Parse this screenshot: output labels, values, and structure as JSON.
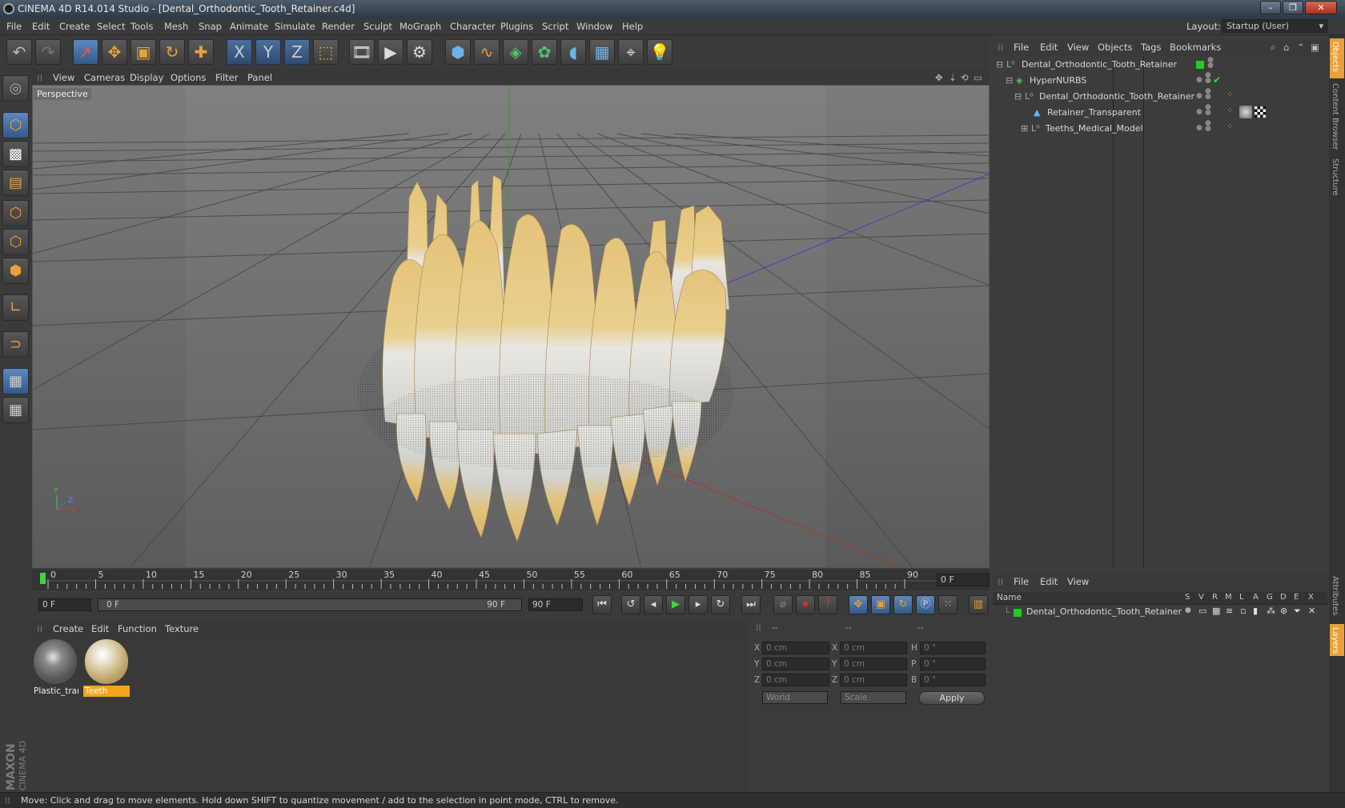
{
  "window": {
    "title": "CINEMA 4D R14.014 Studio - [Dental_Orthodontic_Tooth_Retainer.c4d]",
    "layout_label": "Layout:",
    "layout_value": "Startup (User)"
  },
  "menu": [
    "File",
    "Edit",
    "Create",
    "Select",
    "Tools",
    "Mesh",
    "Snap",
    "Animate",
    "Simulate",
    "Render",
    "Sculpt",
    "MoGraph",
    "Character",
    "Plugins",
    "Script",
    "Window",
    "Help"
  ],
  "toolbar": {
    "icons": [
      "undo-icon",
      "redo-icon",
      "live-select-icon",
      "move-icon",
      "scale-icon",
      "rotate-icon",
      "add-icon",
      "x-axis-icon",
      "y-axis-icon",
      "z-axis-icon",
      "coordinate-system-icon",
      "render-view-icon",
      "render-picture-viewer-icon",
      "render-settings-icon",
      "cube-icon",
      "spline-pen-icon",
      "subdivision-surface-icon",
      "array-icon",
      "deformer-icon",
      "floor-icon",
      "camera-icon",
      "light-icon"
    ],
    "axis_labels": [
      "X",
      "Y",
      "Z"
    ]
  },
  "viewport": {
    "menu": [
      "View",
      "Cameras",
      "Display",
      "Options",
      "Filter",
      "Panel"
    ],
    "label": "Perspective",
    "axis_y": "Y",
    "axis_z": "Z",
    "axis_x": "X"
  },
  "timeline": {
    "ticks": [
      "0",
      "5",
      "10",
      "15",
      "20",
      "25",
      "30",
      "35",
      "40",
      "45",
      "50",
      "55",
      "60",
      "65",
      "70",
      "75",
      "80",
      "85",
      "90"
    ],
    "current_frame": "0 F",
    "start_field": "0 F",
    "range_left": "0 F",
    "range_right": "90 F",
    "end_field": "90 F"
  },
  "materials": {
    "menu": [
      "Create",
      "Edit",
      "Function",
      "Texture"
    ],
    "items": [
      {
        "name": "Plastic_tran",
        "selected": false
      },
      {
        "name": "Teeth",
        "selected": true
      }
    ]
  },
  "coordinates": {
    "headers": [
      "--",
      "--",
      "--"
    ],
    "rows": [
      {
        "a": "X",
        "av": "0 cm",
        "b": "X",
        "bv": "0 cm",
        "c": "H",
        "cv": "0 °"
      },
      {
        "a": "Y",
        "av": "0 cm",
        "b": "Y",
        "bv": "0 cm",
        "c": "P",
        "cv": "0 °"
      },
      {
        "a": "Z",
        "av": "0 cm",
        "b": "Z",
        "bv": "0 cm",
        "c": "B",
        "cv": "0 °"
      }
    ],
    "mode": "World",
    "scale": "Scale",
    "apply": "Apply"
  },
  "objects": {
    "menu": [
      "File",
      "Edit",
      "View",
      "Objects",
      "Tags",
      "Bookmarks"
    ],
    "rows": [
      {
        "name": "Dental_Orthodontic_Tooth_Retainer"
      },
      {
        "name": "HyperNURBS"
      },
      {
        "name": "Dental_Orthodontic_Tooth_Retainer"
      },
      {
        "name": "Retainer_Transparent"
      },
      {
        "name": "Teeths_Medical_Model"
      }
    ]
  },
  "side_tabs": [
    "Objects",
    "Content Browser",
    "Structure",
    "Attributes",
    "Layers"
  ],
  "layers": {
    "menu": [
      "File",
      "Edit",
      "View"
    ],
    "header_name": "Name",
    "columns": [
      "S",
      "V",
      "R",
      "M",
      "L",
      "A",
      "G",
      "D",
      "E",
      "X"
    ],
    "rows": [
      {
        "name": "Dental_Orthodontic_Tooth_Retainer"
      }
    ]
  },
  "status": "Move: Click and drag to move elements. Hold down SHIFT to quantize movement / add to the selection in point mode, CTRL to remove.",
  "brand": "MAXON CINEMA 4D",
  "colors": {
    "accent_orange": "#e8a13a",
    "selection_blue": "#4f7fb6",
    "layer_green": "#22cc22",
    "material_selected": "#f2a51a"
  }
}
